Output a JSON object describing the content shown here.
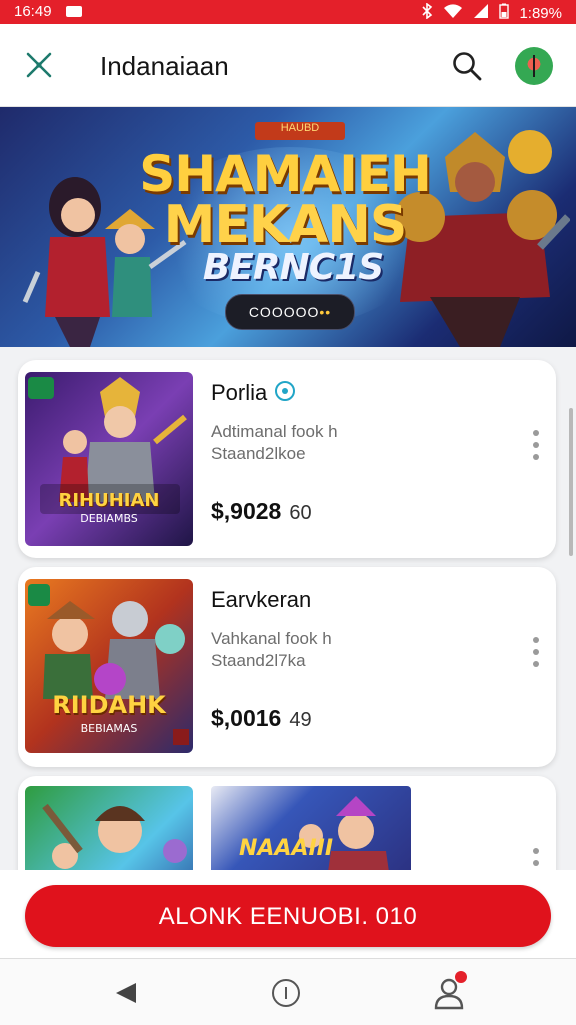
{
  "status_bar": {
    "time": "16:49",
    "battery": "1:89%"
  },
  "header": {
    "title": "Indanaiaan"
  },
  "banner": {
    "tag": "HAUBD",
    "title_line1": "SHAMAIEH",
    "title_line2": "MEKANS",
    "title_line3": "BERNC1S",
    "pager_text": "COOOOO",
    "pager_highlight": "••"
  },
  "products": [
    {
      "name": "Porlia",
      "line1": "Adtimanal fook h",
      "line2": "Staand2lkoe",
      "price": "$,9028",
      "price_secondary": "60",
      "thumb_label": "RIHUHIAN",
      "thumb_sub": "DEBIAMBS"
    },
    {
      "name": "Earvkeran",
      "line1": "Vahkanal fook h",
      "line2": "Staand2l7ka",
      "price": "$,0016",
      "price_secondary": "49",
      "thumb_label": "RIIDAHK",
      "thumb_sub": "BEBIAMAS"
    },
    {
      "name": "",
      "line1": "",
      "line2": "",
      "price": "",
      "price_secondary": "",
      "thumb_label": "NAAAIII",
      "thumb_sub": ""
    }
  ],
  "cta": {
    "label": "ALONK EENUOBI. 010"
  },
  "colors": {
    "primary": "#e0121c",
    "status_bar": "#e4202a"
  },
  "icons": {
    "close": "close-icon",
    "search": "search-icon",
    "avatar": "avatar",
    "back": "back-icon",
    "home": "home-icon",
    "profile": "profile-icon"
  }
}
